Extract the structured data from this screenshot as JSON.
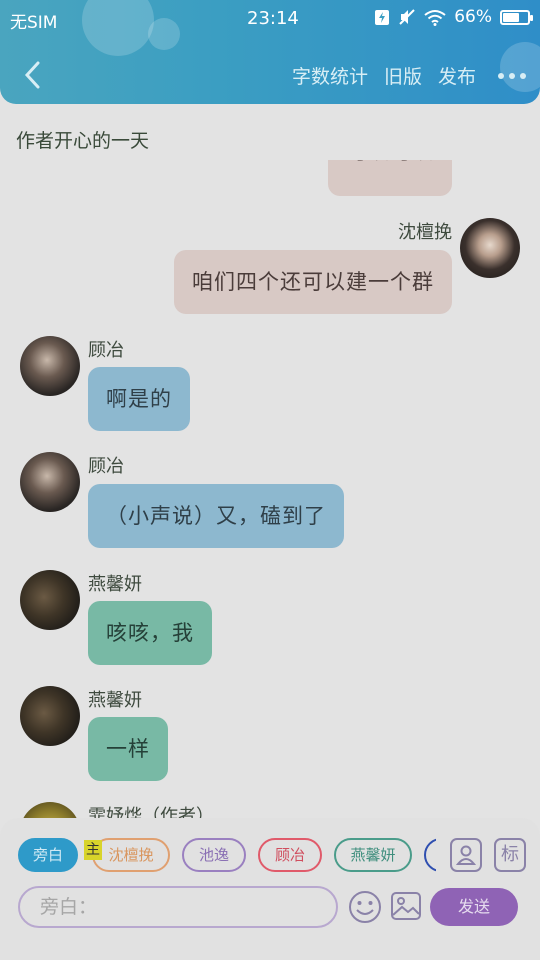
{
  "status_bar": {
    "carrier": "无SIM",
    "time": "23:14",
    "battery_percent": "66%",
    "battery_level": 0.66
  },
  "nav": {
    "back_icon": "chevron-left-icon",
    "actions": [
      "字数统计",
      "旧版",
      "发布"
    ],
    "more_icon": "more-dots-icon"
  },
  "story": {
    "title": "作者开心的一天"
  },
  "messages": [
    {
      "sender": "",
      "text": "可以可以",
      "side": "right",
      "color": "pink",
      "partial": true
    },
    {
      "sender": "沈檀挽",
      "text": "咱们四个还可以建一个群",
      "side": "right",
      "color": "pink"
    },
    {
      "sender": "顾冶",
      "text": "啊是的",
      "side": "left",
      "color": "blue"
    },
    {
      "sender": "顾冶",
      "text": "（小声说）又，磕到了",
      "side": "left",
      "color": "blue"
    },
    {
      "sender": "燕馨妍",
      "text": "咳咳，我",
      "side": "left",
      "color": "green"
    },
    {
      "sender": "燕馨妍",
      "text": "一样",
      "side": "left",
      "color": "green"
    },
    {
      "sender": "霏妤烨（作者）",
      "text": "",
      "side": "left",
      "color": "",
      "partial": true
    }
  ],
  "composer": {
    "roles": [
      {
        "label": "旁白",
        "color": "#2e9ac9",
        "selected": true
      },
      {
        "label": "沈檀挽",
        "color": "#e0a070",
        "selected": false
      },
      {
        "label": "池逸",
        "color": "#9a80c0",
        "selected": false
      },
      {
        "label": "顾冶",
        "color": "#e05a6a",
        "selected": false
      },
      {
        "label": "燕馨妍",
        "color": "#4a9c8a",
        "selected": false
      }
    ],
    "main_badge": "主",
    "role_manage_icon": "person-card-icon",
    "mark_label": "标",
    "input_placeholder": "旁白：",
    "emoji_icon": "smiley-icon",
    "image_icon": "image-icon",
    "send_label": "发送",
    "send_color": "#8f63b5"
  }
}
